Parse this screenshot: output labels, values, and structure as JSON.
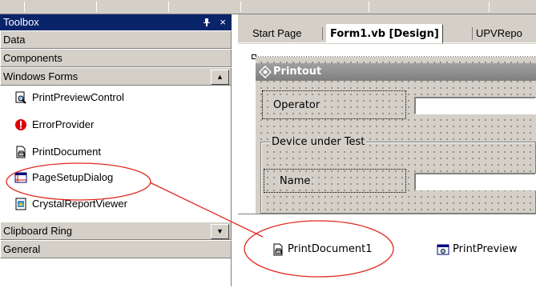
{
  "toolbox": {
    "title": "Toolbox",
    "pin_glyph": "२",
    "close_glyph": "×",
    "tabs_top": [
      "Data",
      "Components",
      "Windows Forms"
    ],
    "items": [
      {
        "label": "PrintPreviewControl",
        "icon": "print-preview-icon"
      },
      {
        "label": "ErrorProvider",
        "icon": "error-icon"
      },
      {
        "label": "PrintDocument",
        "icon": "print-document-icon"
      },
      {
        "label": "PageSetupDialog",
        "icon": "page-setup-icon"
      },
      {
        "label": "CrystalReportViewer",
        "icon": "crystal-report-icon"
      }
    ],
    "tabs_bottom": [
      "Clipboard Ring",
      "General"
    ],
    "scroll_up": "▲",
    "scroll_down": "▼"
  },
  "editor": {
    "tabs": [
      "Start Page",
      "Form1.vb [Design]",
      "UPVRepo"
    ],
    "active_tab": "Form1.vb [Design]",
    "form": {
      "title": "Printout",
      "operator_label": "Operator",
      "group_label": "Device under Test",
      "name_label": "Name"
    },
    "tray": {
      "items": [
        "PrintDocument1",
        "PrintPreview"
      ]
    }
  },
  "colors": {
    "title_bar": "#0a246a",
    "chrome": "#d4d0c8",
    "annotation": "#e0281e"
  }
}
